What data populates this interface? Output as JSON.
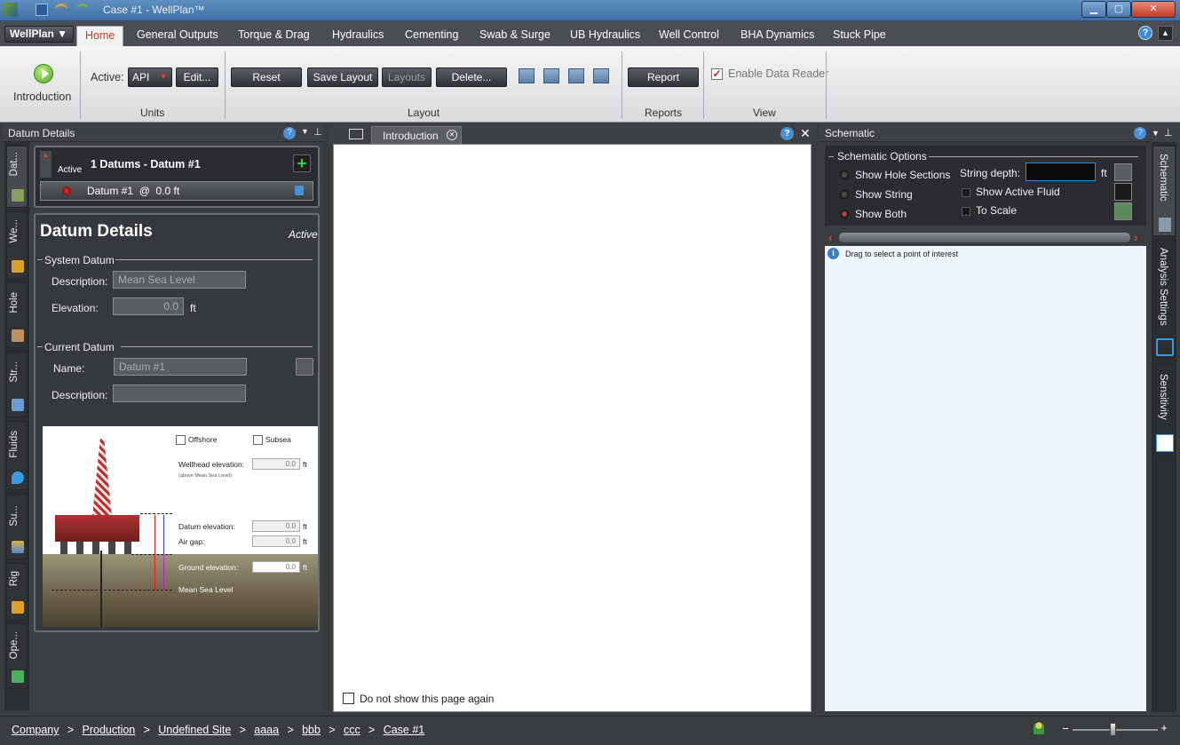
{
  "window": {
    "title": "Case #1 - WellPlan™",
    "minimize": "▁",
    "maximize": "▢",
    "close": "✕"
  },
  "ribbon": {
    "app_menu": "WellPlan ▼",
    "tabs": [
      "Home",
      "General Outputs",
      "Torque & Drag",
      "Hydraulics",
      "Cementing",
      "Swab & Surge",
      "UB Hydraulics",
      "Well Control",
      "BHA Dynamics",
      "Stuck Pipe"
    ],
    "introduction_label": "Introduction",
    "active_label": "Active:",
    "units_value": "API",
    "edit_label": "Edit...",
    "groups": {
      "units": "Units",
      "layout": "Layout",
      "reports": "Reports",
      "view": "View"
    },
    "reset_label": "Reset",
    "save_layout_label": "Save Layout",
    "layouts_label": "Layouts",
    "delete_label": "Delete...",
    "report_label": "Report",
    "enable_reader_label": "Enable Data Reader"
  },
  "left_panel": {
    "header": "Datum Details",
    "vtabs": [
      "Dat...",
      "We...",
      "Hole",
      "Str...",
      "Fluids",
      "Su...",
      "Rig",
      "Ope..."
    ],
    "datums_title": "1 Datums - Datum #1",
    "active_tag": "Active",
    "datum_row": "Datum #1  @  0.0 ft",
    "details_title": "Datum Details",
    "details_active": "Active",
    "system_datum": "System Datum",
    "description_label": "Description:",
    "description_value": "Mean Sea Level",
    "elevation_label": "Elevation:",
    "elevation_value": "0.0",
    "unit_ft": "ft",
    "current_datum": "Current Datum",
    "name_label": "Name:",
    "name_value": "Datum #1",
    "current_description_label": "Description:",
    "diagram": {
      "offshore": "Offshore",
      "subsea": "Subsea",
      "wellhead_label": "Wellhead elevation:",
      "wellhead_note": "(above Mean Sea Level)",
      "wellhead_value": "0.0",
      "datum_elev_label": "Datum elevation:",
      "datum_elev_value": "0.0",
      "air_gap_label": "Air gap:",
      "air_gap_value": "0.0",
      "ground_label": "Ground elevation:",
      "ground_value": "0.0",
      "msl_label": "Mean Sea Level",
      "unit": "ft"
    }
  },
  "center_panel": {
    "tab_label": "Introduction",
    "dont_show": "Do not show this page again"
  },
  "right_panel": {
    "header": "Schematic",
    "options_title": "Schematic Options",
    "show_hole_sections": "Show Hole Sections",
    "show_string": "Show String",
    "show_both": "Show Both",
    "string_depth_label": "String depth:",
    "string_depth_unit": "ft",
    "show_active_fluid": "Show Active Fluid",
    "to_scale": "To Scale",
    "hint": "Drag to select a point of interest",
    "vtabs": [
      "Schematic",
      "Analysis Settings",
      "Sensitivity"
    ]
  },
  "breadcrumb": [
    "Company",
    "Production",
    "Undefined Site",
    "aaaa",
    "bbb",
    "ccc",
    "Case #1"
  ],
  "breadcrumb_sep": ">",
  "zoom": {
    "minus": "−",
    "plus": "+"
  },
  "colors": {
    "accent": "#d83a20",
    "panel": "#3a3d40",
    "tab_blue": "#2a7fc0"
  }
}
